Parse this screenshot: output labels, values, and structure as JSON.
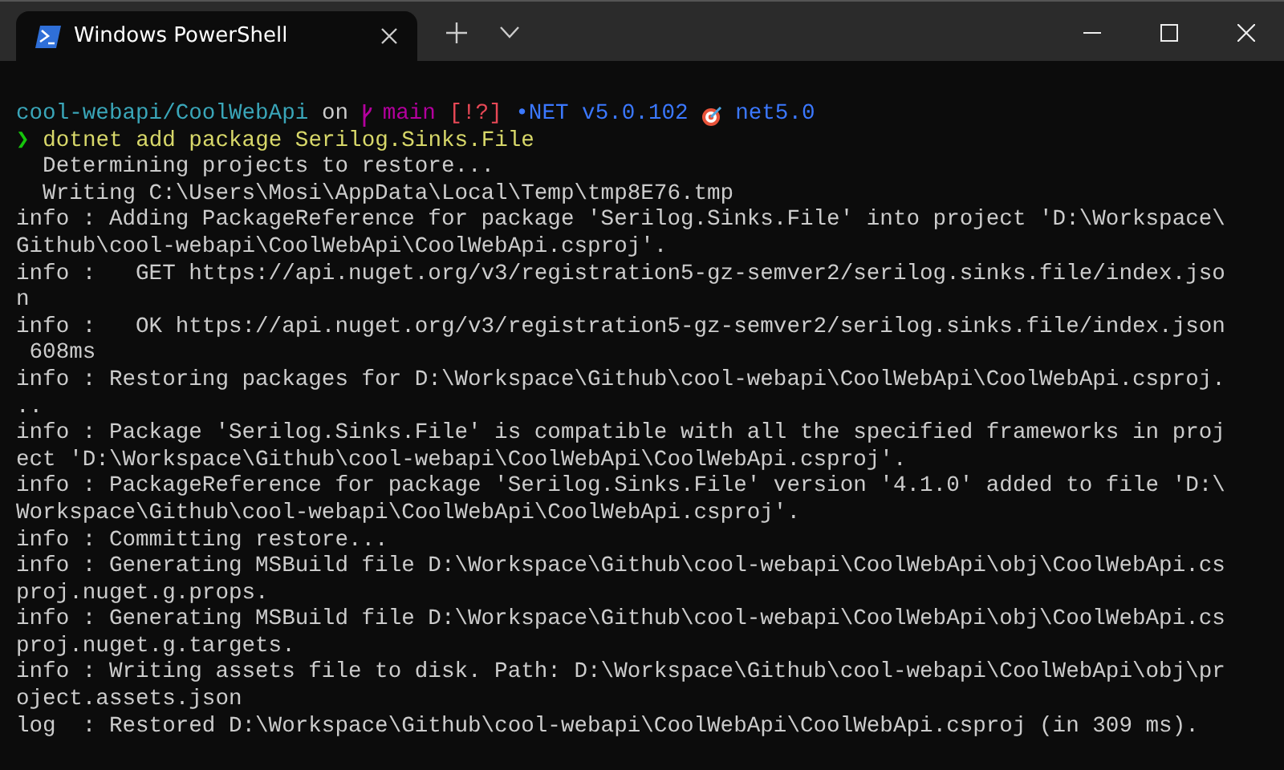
{
  "window": {
    "title": "Windows PowerShell"
  },
  "prompt": [
    {
      "kind": "path",
      "text": "cool-webapi/CoolWebApi",
      "color": "#3aa6b9"
    },
    {
      "kind": "plain",
      "text": "on"
    },
    {
      "kind": "branch",
      "text": "main",
      "color": "#b4009e"
    },
    {
      "kind": "status",
      "text": "[!?]",
      "color": "#e74856"
    },
    {
      "kind": "sdk",
      "text": "•NET v5.0.102",
      "color": "#3b78ff"
    },
    {
      "kind": "target",
      "text": "net5.0",
      "color": "#3b78ff"
    }
  ],
  "command": {
    "symbol": "❯",
    "text": "dotnet add package Serilog.Sinks.File"
  },
  "output": [
    "  Determining projects to restore...",
    "  Writing C:\\Users\\Mosi\\AppData\\Local\\Temp\\tmp8E76.tmp",
    "info : Adding PackageReference for package 'Serilog.Sinks.File' into project 'D:\\Workspace\\",
    "Github\\cool-webapi\\CoolWebApi\\CoolWebApi.csproj'.",
    "info :   GET https://api.nuget.org/v3/registration5-gz-semver2/serilog.sinks.file/index.jso",
    "n",
    "info :   OK https://api.nuget.org/v3/registration5-gz-semver2/serilog.sinks.file/index.json",
    " 608ms",
    "info : Restoring packages for D:\\Workspace\\Github\\cool-webapi\\CoolWebApi\\CoolWebApi.csproj.",
    "..",
    "info : Package 'Serilog.Sinks.File' is compatible with all the specified frameworks in proj",
    "ect 'D:\\Workspace\\Github\\cool-webapi\\CoolWebApi\\CoolWebApi.csproj'.",
    "info : PackageReference for package 'Serilog.Sinks.File' version '4.1.0' added to file 'D:\\",
    "Workspace\\Github\\cool-webapi\\CoolWebApi\\CoolWebApi.csproj'.",
    "info : Committing restore...",
    "info : Generating MSBuild file D:\\Workspace\\Github\\cool-webapi\\CoolWebApi\\obj\\CoolWebApi.cs",
    "proj.nuget.g.props.",
    "info : Generating MSBuild file D:\\Workspace\\Github\\cool-webapi\\CoolWebApi\\obj\\CoolWebApi.cs",
    "proj.nuget.g.targets.",
    "info : Writing assets file to disk. Path: D:\\Workspace\\Github\\cool-webapi\\CoolWebApi\\obj\\pr",
    "oject.assets.json",
    "log  : Restored D:\\Workspace\\Github\\cool-webapi\\CoolWebApi\\CoolWebApi.csproj (in 309 ms)."
  ]
}
